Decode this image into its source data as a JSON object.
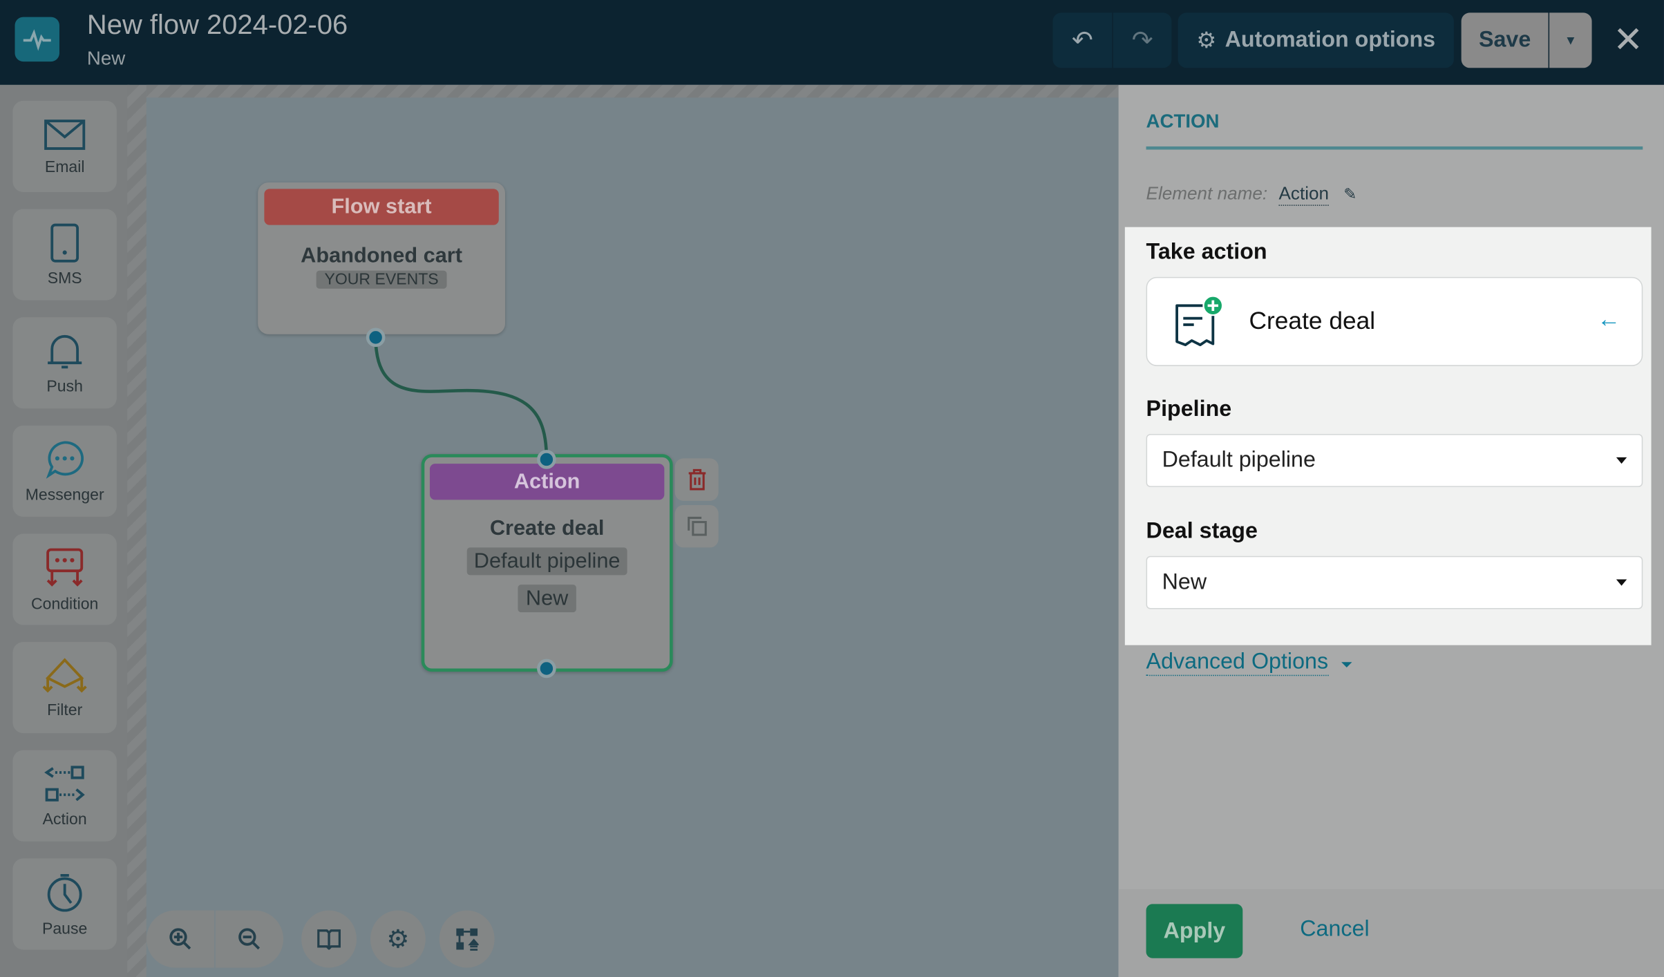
{
  "header": {
    "title": "New flow 2024-02-06",
    "status": "New",
    "automation_options_label": "Automation options",
    "save_label": "Save"
  },
  "sidebar": {
    "items": [
      {
        "label": "Email",
        "icon": "envelope-icon"
      },
      {
        "label": "SMS",
        "icon": "phone-icon"
      },
      {
        "label": "Push",
        "icon": "bell-icon"
      },
      {
        "label": "Messenger",
        "icon": "chat-bubble-icon"
      },
      {
        "label": "Condition",
        "icon": "condition-icon"
      },
      {
        "label": "Filter",
        "icon": "filter-icon"
      },
      {
        "label": "Action",
        "icon": "action-icon"
      },
      {
        "label": "Pause",
        "icon": "stopwatch-icon"
      }
    ]
  },
  "canvas": {
    "start_node": {
      "header": "Flow start",
      "title": "Abandoned cart",
      "tag": "YOUR EVENTS",
      "color": "#a54a46"
    },
    "action_node": {
      "header": "Action",
      "title": "Create deal",
      "pipeline": "Default pipeline",
      "stage": "New",
      "color": "#7d4a90"
    }
  },
  "panel": {
    "title": "ACTION",
    "element_name_label": "Element name:",
    "element_name_value": "Action",
    "take_action_label": "Take action",
    "take_action_value": "Create deal",
    "pipeline_label": "Pipeline",
    "pipeline_value": "Default pipeline",
    "deal_stage_label": "Deal stage",
    "deal_stage_value": "New",
    "advanced_options_label": "Advanced Options",
    "apply_label": "Apply",
    "cancel_label": "Cancel"
  },
  "colors": {
    "accent": "#0d6a80",
    "apply": "#1b7a52",
    "header_bg": "#0c2330"
  }
}
